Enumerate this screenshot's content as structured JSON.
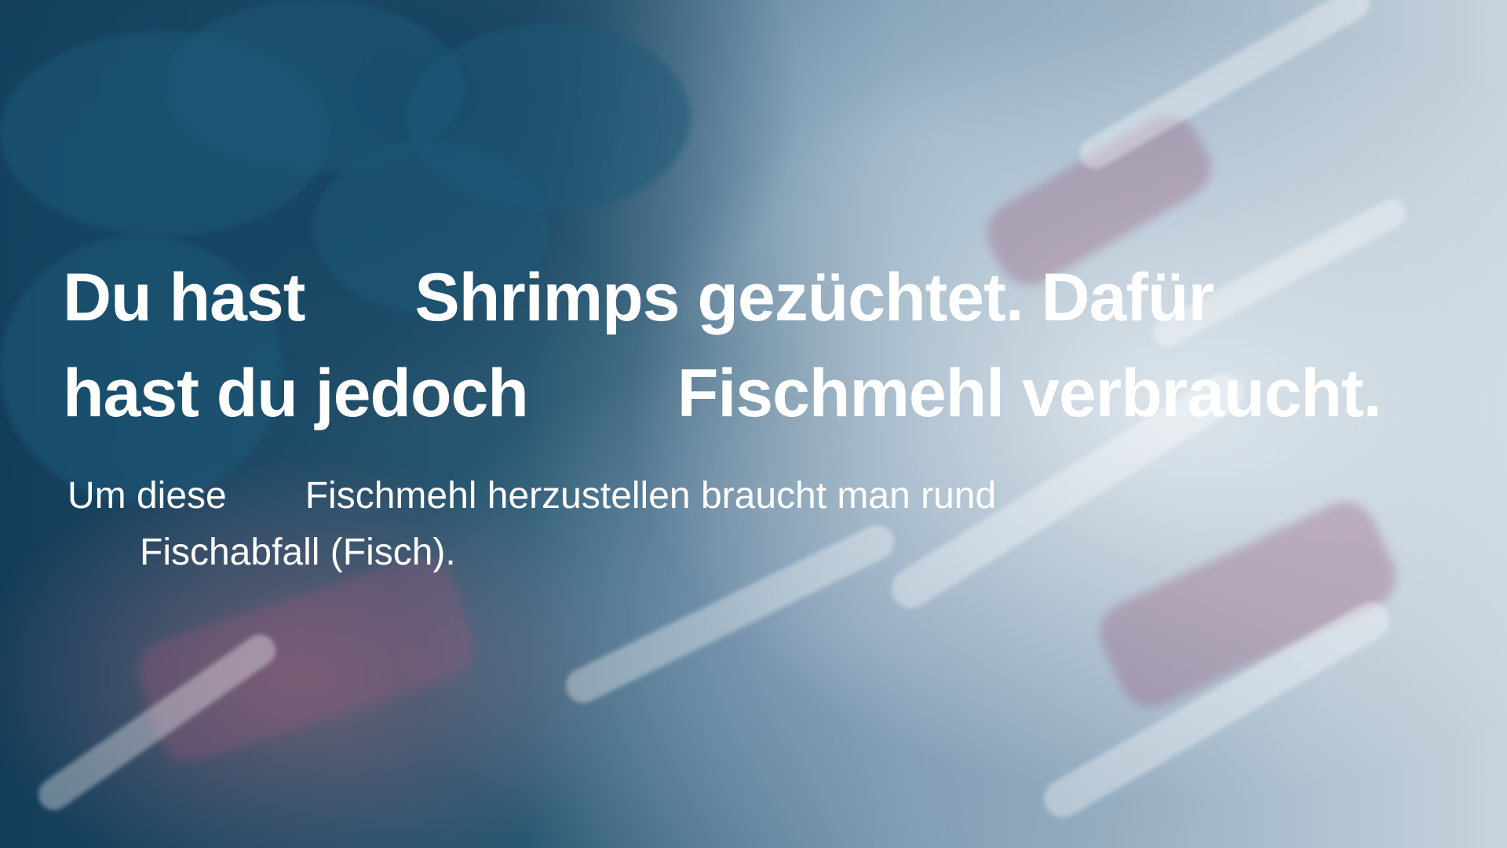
{
  "slide": {
    "headline": {
      "line1_part1": "Du hast",
      "line1_part2": "Shrimps gezüchtet. Dafür",
      "line2_part1": "hast du jedoch",
      "line2_part2": "Fischmehl verbraucht."
    },
    "body": {
      "line1_part1": "Um diese",
      "line1_part2": "Fischmehl herzustellen braucht man rund",
      "line2_part1": "Fischabfall (Fisch)."
    }
  },
  "colors": {
    "text": "#ffffff",
    "background_dark": "#123c58",
    "background_light": "#c7d3de"
  }
}
